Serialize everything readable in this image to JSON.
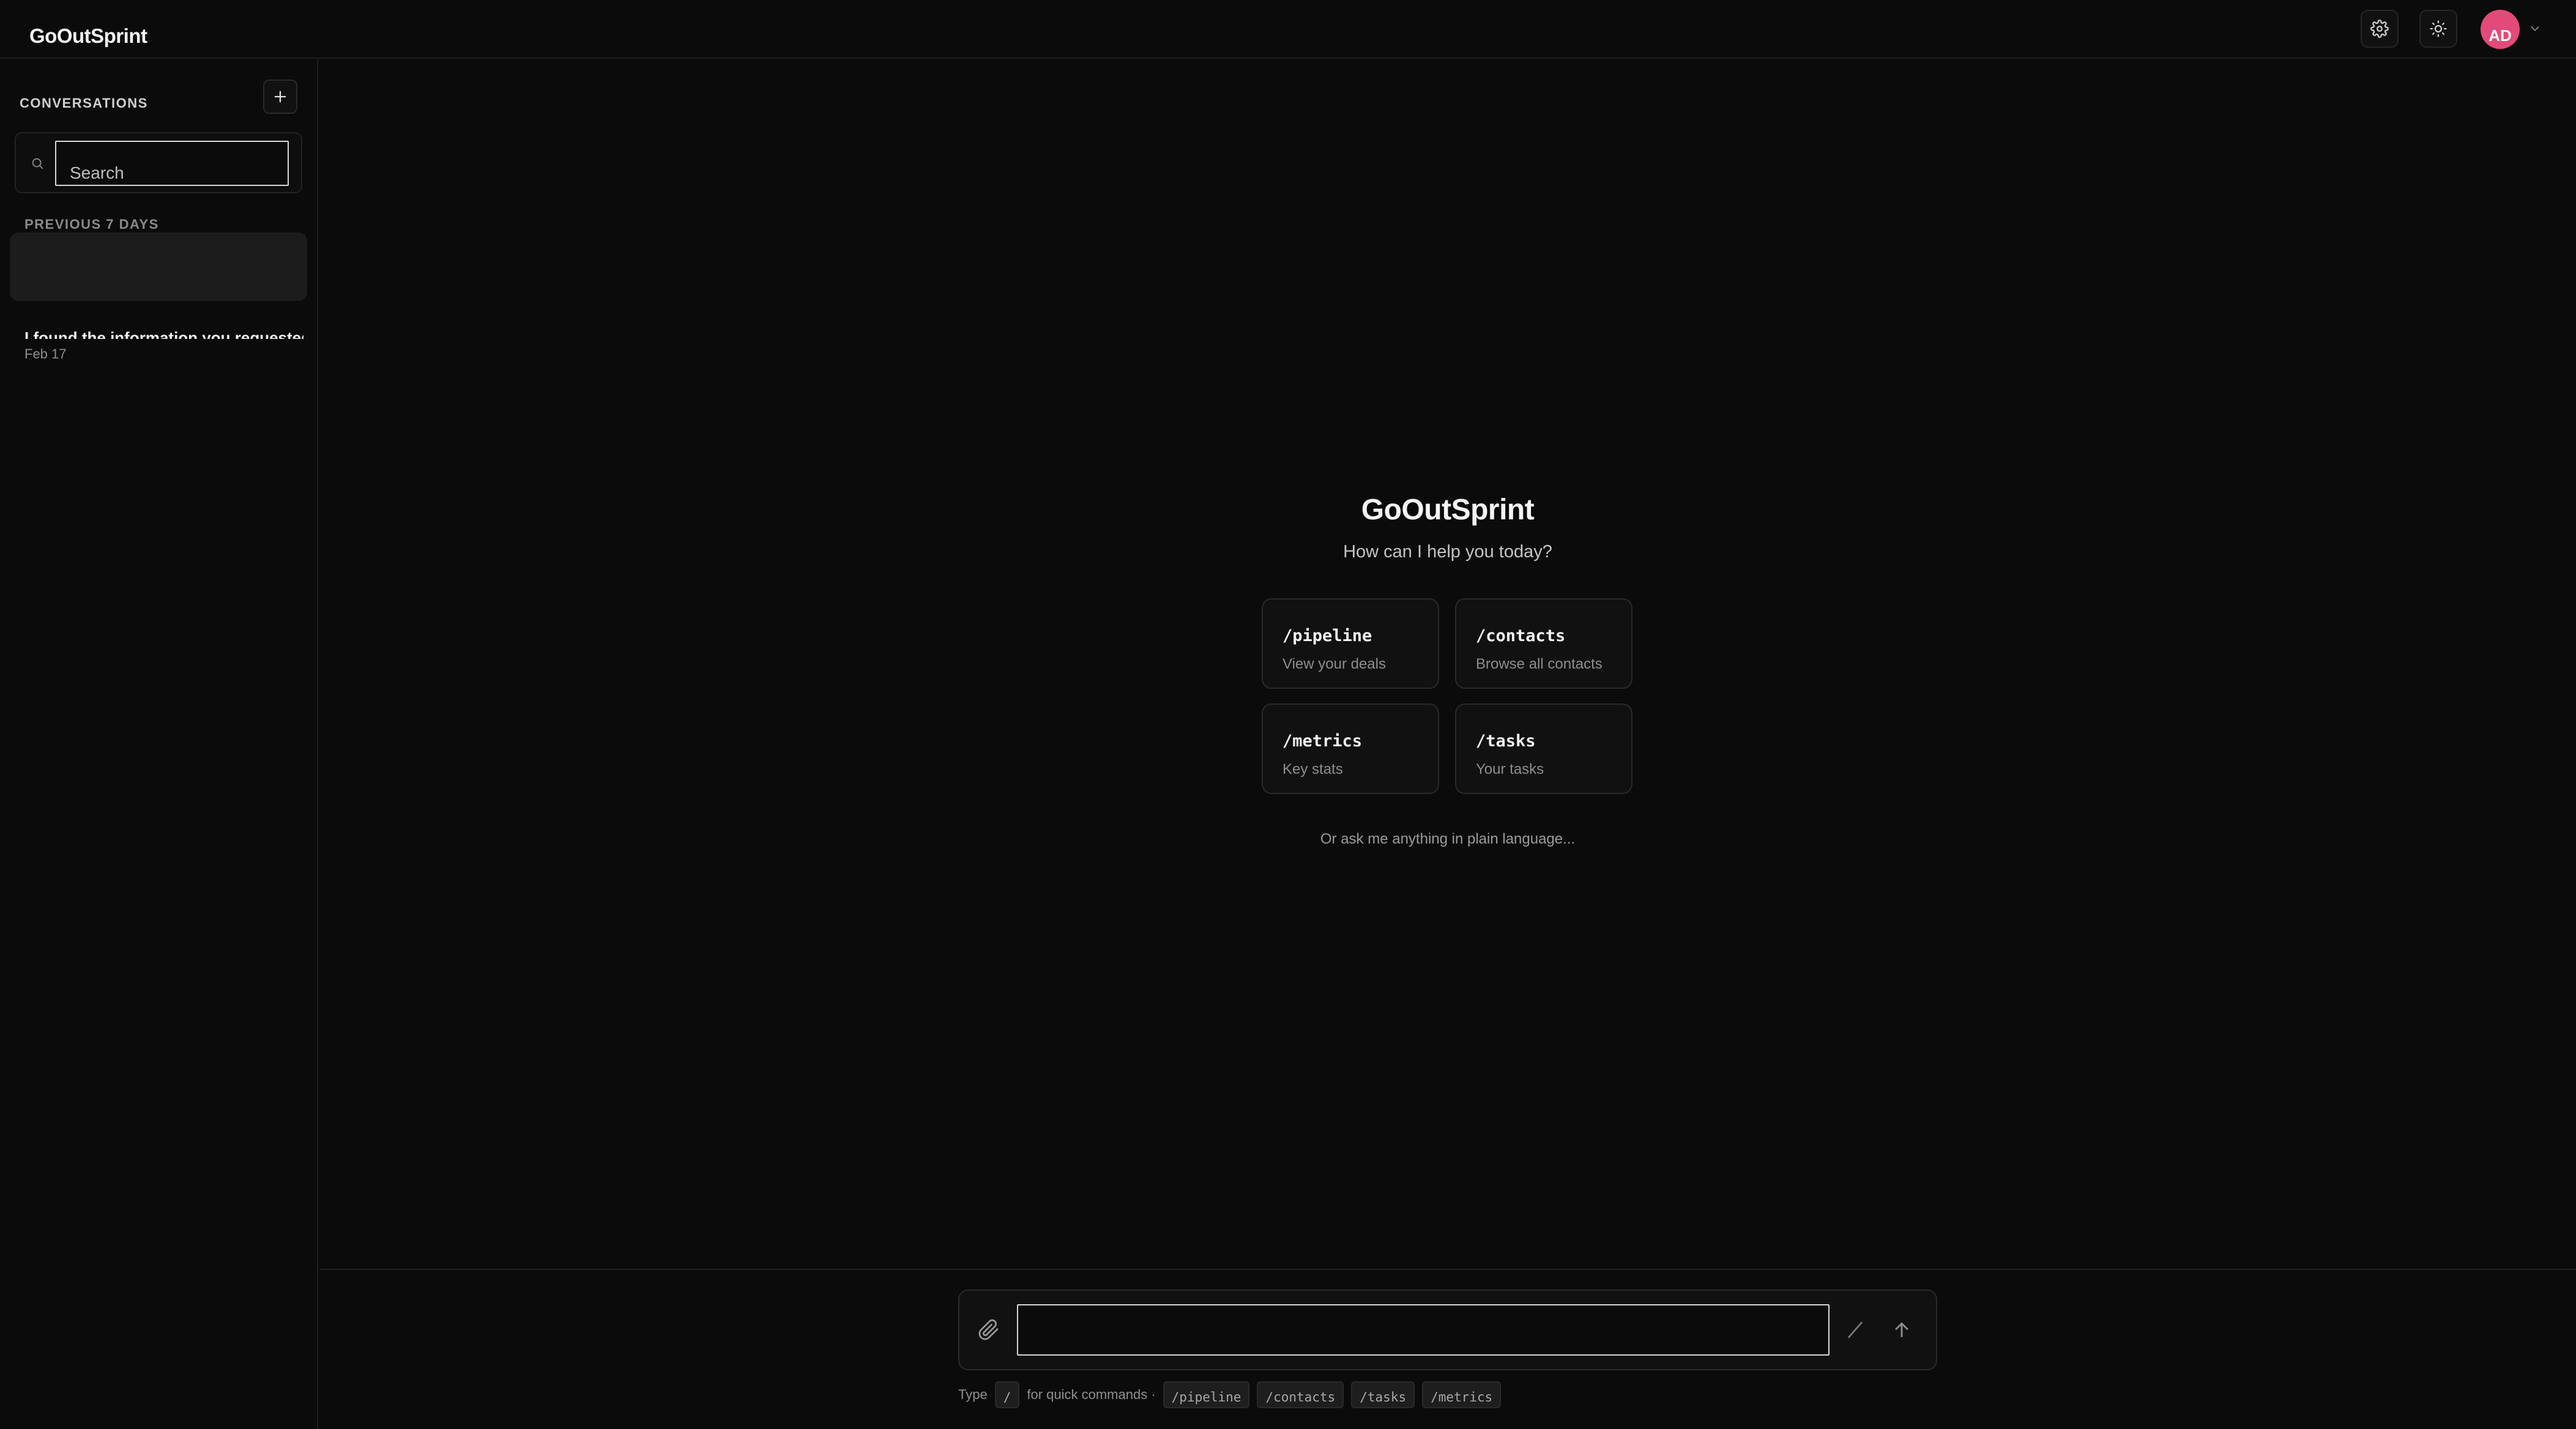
{
  "app": {
    "brand": "GoOutSprint"
  },
  "header": {
    "settings_icon": "gear-icon",
    "theme_icon": "sun-icon",
    "avatar_initials": "AD",
    "avatar_color": "#e24a7a"
  },
  "sidebar": {
    "title": "CONVERSATIONS",
    "search": {
      "placeholder": "Search",
      "value": ""
    },
    "section_label": "PREVIOUS 7 DAYS",
    "conversations": [
      {
        "title": "",
        "date": ""
      },
      {
        "title": "I found the information you requested",
        "date": "Feb 17"
      }
    ]
  },
  "main": {
    "title": "GoOutSprint",
    "subtitle": "How can I help you today?",
    "cards": [
      {
        "command": "/pipeline",
        "description": "View your deals"
      },
      {
        "command": "/contacts",
        "description": "Browse all contacts"
      },
      {
        "command": "/metrics",
        "description": "Key stats"
      },
      {
        "command": "/tasks",
        "description": "Your tasks"
      }
    ],
    "hint": "Or ask me anything in plain language..."
  },
  "composer": {
    "placeholder": "",
    "hint_prefix": "Type",
    "hint_key": "/",
    "hint_suffix": "for quick commands ·",
    "quick_commands": [
      "/pipeline",
      "/contacts",
      "/tasks",
      "/metrics"
    ]
  }
}
